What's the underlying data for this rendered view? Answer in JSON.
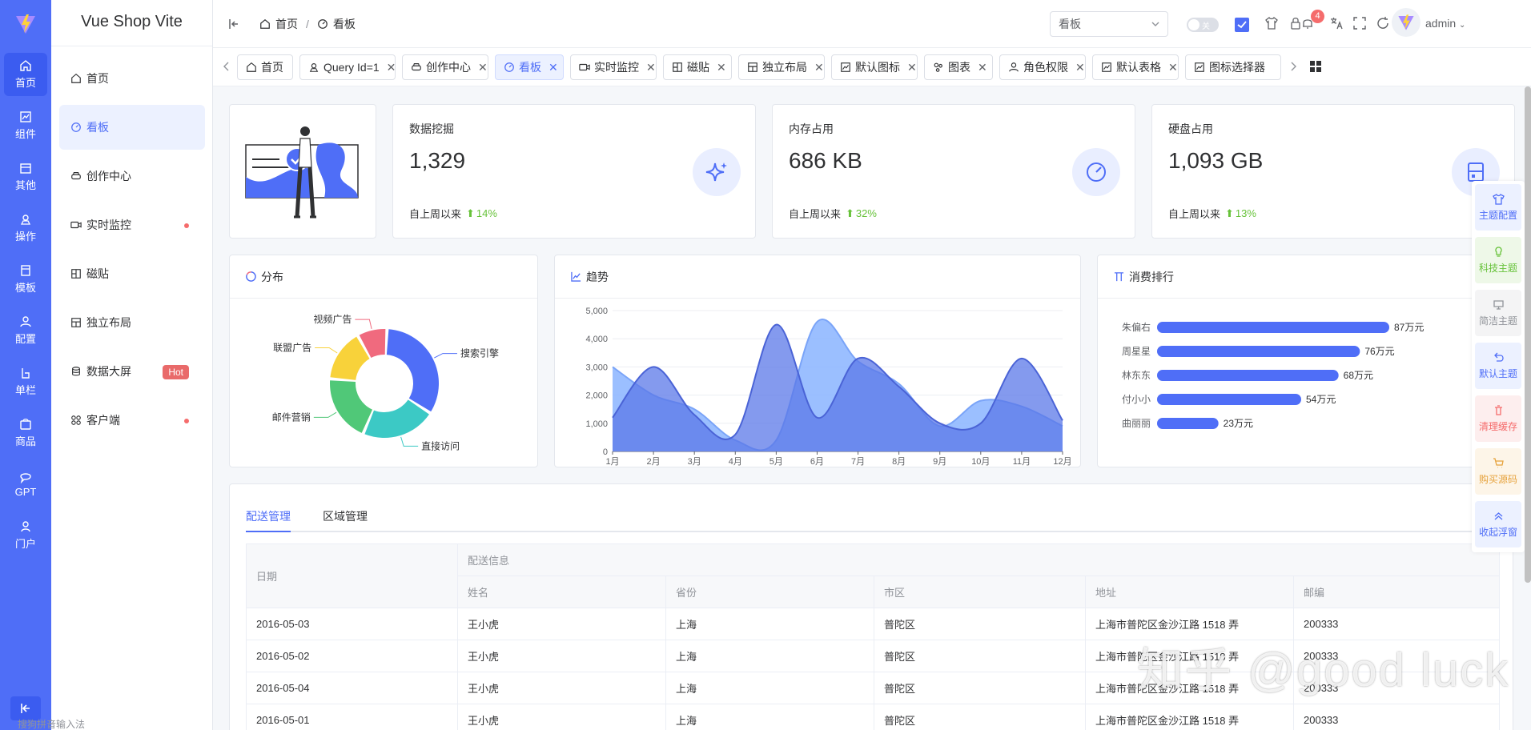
{
  "app": {
    "title": "Vue Shop Vite"
  },
  "rail": {
    "items": [
      {
        "label": "首页",
        "icon": "home-icon"
      },
      {
        "label": "组件",
        "icon": "component-icon"
      },
      {
        "label": "其他",
        "icon": "other-icon"
      },
      {
        "label": "操作",
        "icon": "operate-icon"
      },
      {
        "label": "模板",
        "icon": "template-icon"
      },
      {
        "label": "配置",
        "icon": "config-icon"
      },
      {
        "label": "单栏",
        "icon": "single-column-icon"
      },
      {
        "label": "商品",
        "icon": "goods-icon"
      },
      {
        "label": "GPT",
        "icon": "gpt-icon"
      },
      {
        "label": "门户",
        "icon": "portal-icon"
      }
    ]
  },
  "menu": {
    "items": [
      {
        "label": "首页"
      },
      {
        "label": "看板"
      },
      {
        "label": "创作中心"
      },
      {
        "label": "实时监控"
      },
      {
        "label": "磁贴"
      },
      {
        "label": "独立布局"
      },
      {
        "label": "数据大屏",
        "badge": "Hot"
      },
      {
        "label": "客户端"
      }
    ]
  },
  "header": {
    "breadcrumb": [
      "首页",
      "看板"
    ],
    "search_select": "看板",
    "toggle_text": "关",
    "notification_count": "4",
    "user": "admin"
  },
  "tabs": [
    {
      "label": "首页"
    },
    {
      "label": "Query Id=1"
    },
    {
      "label": "创作中心"
    },
    {
      "label": "看板"
    },
    {
      "label": "实时监控"
    },
    {
      "label": "磁贴"
    },
    {
      "label": "独立布局"
    },
    {
      "label": "默认图标"
    },
    {
      "label": "图表"
    },
    {
      "label": "角色权限"
    },
    {
      "label": "默认表格"
    },
    {
      "label": "图标选择器"
    }
  ],
  "stats": [
    {
      "label": "数据挖掘",
      "value": "1,329",
      "since": "自上周以来",
      "change": "14%"
    },
    {
      "label": "内存占用",
      "value": "686 KB",
      "since": "自上周以来",
      "change": "32%"
    },
    {
      "label": "硬盘占用",
      "value": "1,093 GB",
      "since": "自上周以来",
      "change": "13%"
    }
  ],
  "charts": {
    "distribution_title": "分布",
    "trend_title": "趋势",
    "ranking_title": "消费排行"
  },
  "chart_data": [
    {
      "type": "pie",
      "title": "分布",
      "categories": [
        "搜索引擎",
        "直接访问",
        "邮件营销",
        "联盟广告",
        "视频广告"
      ],
      "values": [
        30,
        20,
        18,
        14,
        8
      ],
      "colors": [
        "#4f6ef7",
        "#3cc9c5",
        "#50c878",
        "#f8d23a",
        "#f06a7e"
      ]
    },
    {
      "type": "area",
      "title": "趋势",
      "categories": [
        "1月",
        "2月",
        "3月",
        "4月",
        "5月",
        "6月",
        "7月",
        "8月",
        "9月",
        "10月",
        "11月",
        "12月"
      ],
      "yticks": [
        "0",
        "1,000",
        "2,000",
        "3,000",
        "4,000",
        "5,000"
      ],
      "ylim": [
        0,
        5000
      ],
      "series": [
        {
          "values": [
            3000,
            2000,
            1500,
            400,
            400,
            4600,
            3200,
            2400,
            900,
            1800,
            1600,
            900
          ],
          "color": "#8ab4ff"
        },
        {
          "values": [
            1200,
            3000,
            1300,
            600,
            4500,
            1200,
            3300,
            2300,
            1000,
            1000,
            3300,
            1100
          ],
          "color": "#5b78e8"
        }
      ]
    },
    {
      "type": "bar",
      "title": "消费排行",
      "categories": [
        "朱偏右",
        "周星星",
        "林东东",
        "付小小",
        "曲丽丽"
      ],
      "values": [
        87,
        76,
        68,
        54,
        23
      ],
      "labels": [
        "87万元",
        "76万元",
        "68万元",
        "54万元",
        "23万元"
      ],
      "xlim": [
        0,
        87
      ],
      "color": "#4f6ef7"
    }
  ],
  "table": {
    "tabs": [
      "配送管理",
      "区域管理"
    ],
    "group_header": "配送信息",
    "date_header": "日期",
    "columns": [
      "姓名",
      "省份",
      "市区",
      "地址",
      "邮编"
    ],
    "rows": [
      [
        "2016-05-03",
        "王小虎",
        "上海",
        "普陀区",
        "上海市普陀区金沙江路 1518 弄",
        "200333"
      ],
      [
        "2016-05-02",
        "王小虎",
        "上海",
        "普陀区",
        "上海市普陀区金沙江路 1518 弄",
        "200333"
      ],
      [
        "2016-05-04",
        "王小虎",
        "上海",
        "普陀区",
        "上海市普陀区金沙江路 1518 弄",
        "200333"
      ],
      [
        "2016-05-01",
        "王小虎",
        "上海",
        "普陀区",
        "上海市普陀区金沙江路 1518 弄",
        "200333"
      ]
    ]
  },
  "float_panel": [
    {
      "label": "主题配置",
      "color": "#4f6ef7",
      "bg": "#ecf1ff"
    },
    {
      "label": "科技主题",
      "color": "#67c23a",
      "bg": "#eef8e8"
    },
    {
      "label": "简洁主题",
      "color": "#909399",
      "bg": "#f4f4f5"
    },
    {
      "label": "默认主题",
      "color": "#4f6ef7",
      "bg": "#ecf1ff"
    },
    {
      "label": "清理缓存",
      "color": "#f56c6c",
      "bg": "#fdeeee"
    },
    {
      "label": "购买源码",
      "color": "#e6a23c",
      "bg": "#fdf5e8"
    },
    {
      "label": "收起浮窗",
      "color": "#4f6ef7",
      "bg": "#ecf1ff"
    }
  ],
  "watermark": "知乎 @good luck",
  "ime_text": "搜狗拼音输入法"
}
